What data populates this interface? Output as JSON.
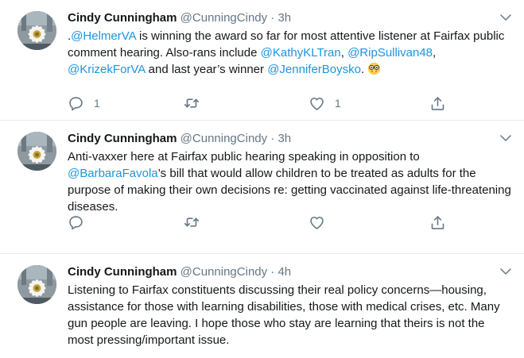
{
  "tweets": [
    {
      "name": "Cindy Cunningham",
      "handle": "@CunningCindy",
      "separator": "·",
      "time": "3h",
      "text_parts": [
        ".",
        "@HelmerVA",
        " is winning the award so far for most attentive listener at Fairfax public comment hearing. Also-rans include ",
        "@KathyKLTran",
        ", ",
        "@RipSullivan48",
        ", ",
        "@KrizekForVA",
        " and last year’s winner ",
        "@JenniferBoysko",
        ". "
      ],
      "emoji": "nerd-face",
      "reply_count": "1",
      "retweet_count": "",
      "like_count": "1"
    },
    {
      "name": "Cindy Cunningham",
      "handle": "@CunningCindy",
      "separator": "·",
      "time": "3h",
      "text_parts": [
        "Anti-vaxxer here at Fairfax public hearing speaking in opposition to ",
        "@BarbaraFavola",
        "’s bill that would allow children to be treated as adults for the purpose of making their own decisions re: getting vaccinated against life-threatening diseases."
      ],
      "reply_count": "",
      "retweet_count": "",
      "like_count": ""
    },
    {
      "name": "Cindy Cunningham",
      "handle": "@CunningCindy",
      "separator": "·",
      "time": "4h",
      "text": "Listening to Fairfax constituents discussing their real policy concerns—housing, assistance for those with learning disabilities, those with medical crises, etc. Many gun people are leaving. I hope those who stay are learning that theirs is not the most pressing/important issue."
    }
  ],
  "colors": {
    "link": "#1b95e0",
    "secondary_text": "#657786",
    "divider": "#e6ecf0"
  },
  "icons": [
    "avatar-photo",
    "chevron-down-icon",
    "reply-icon",
    "retweet-icon",
    "like-icon",
    "share-icon",
    "nerd-face-emoji"
  ]
}
